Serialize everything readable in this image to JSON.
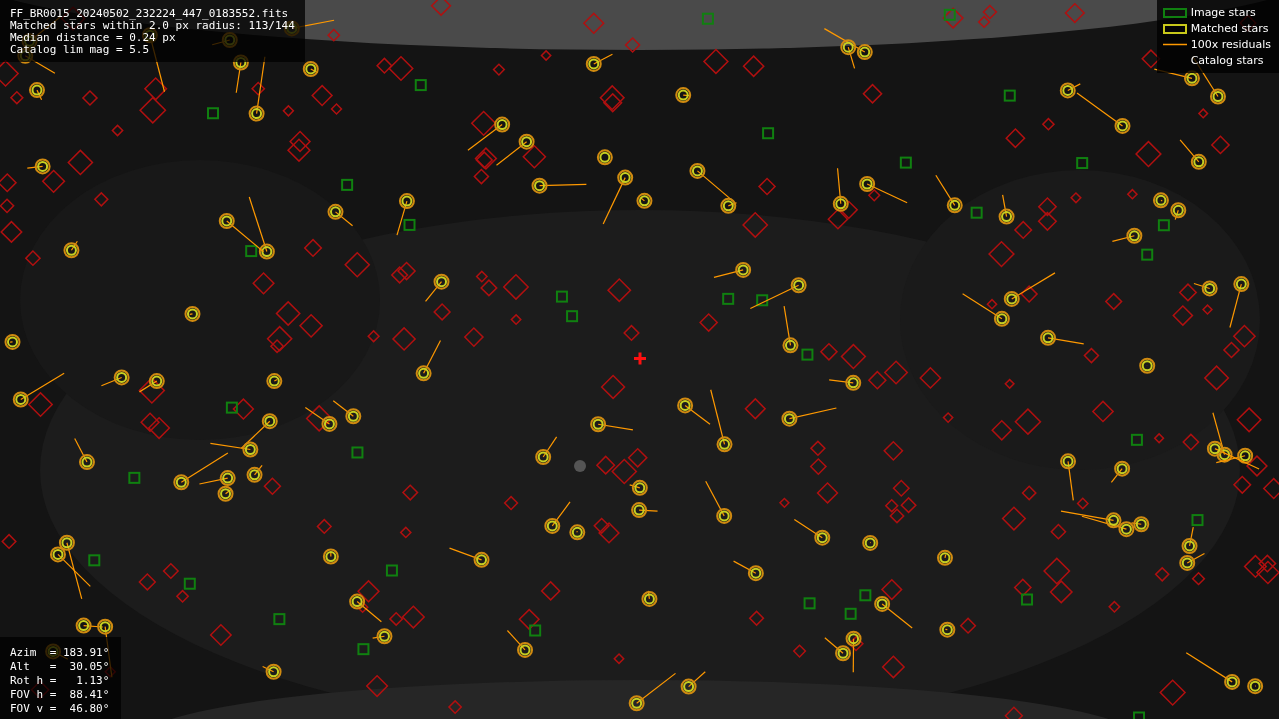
{
  "header": {
    "lines": [
      "FF_BR0015_20240502_232224_447_0183552.fits",
      "Matched stars within 2.0 px radius: 113/144",
      "Median distance = 0.24 px",
      "Catalog lim mag = 5.5"
    ]
  },
  "legend": [
    {
      "label": "Image stars",
      "kind": "image"
    },
    {
      "label": "Matched stars",
      "kind": "matched"
    },
    {
      "label": "100x residuals",
      "kind": "residual"
    },
    {
      "label": "Catalog stars",
      "kind": "catalog"
    }
  ],
  "pointing": [
    "Azim  = 183.91°",
    "Alt   =  30.05°",
    "Rot h =   1.13°",
    "FOV h =  88.41°",
    "FOV v =  46.80°"
  ]
}
